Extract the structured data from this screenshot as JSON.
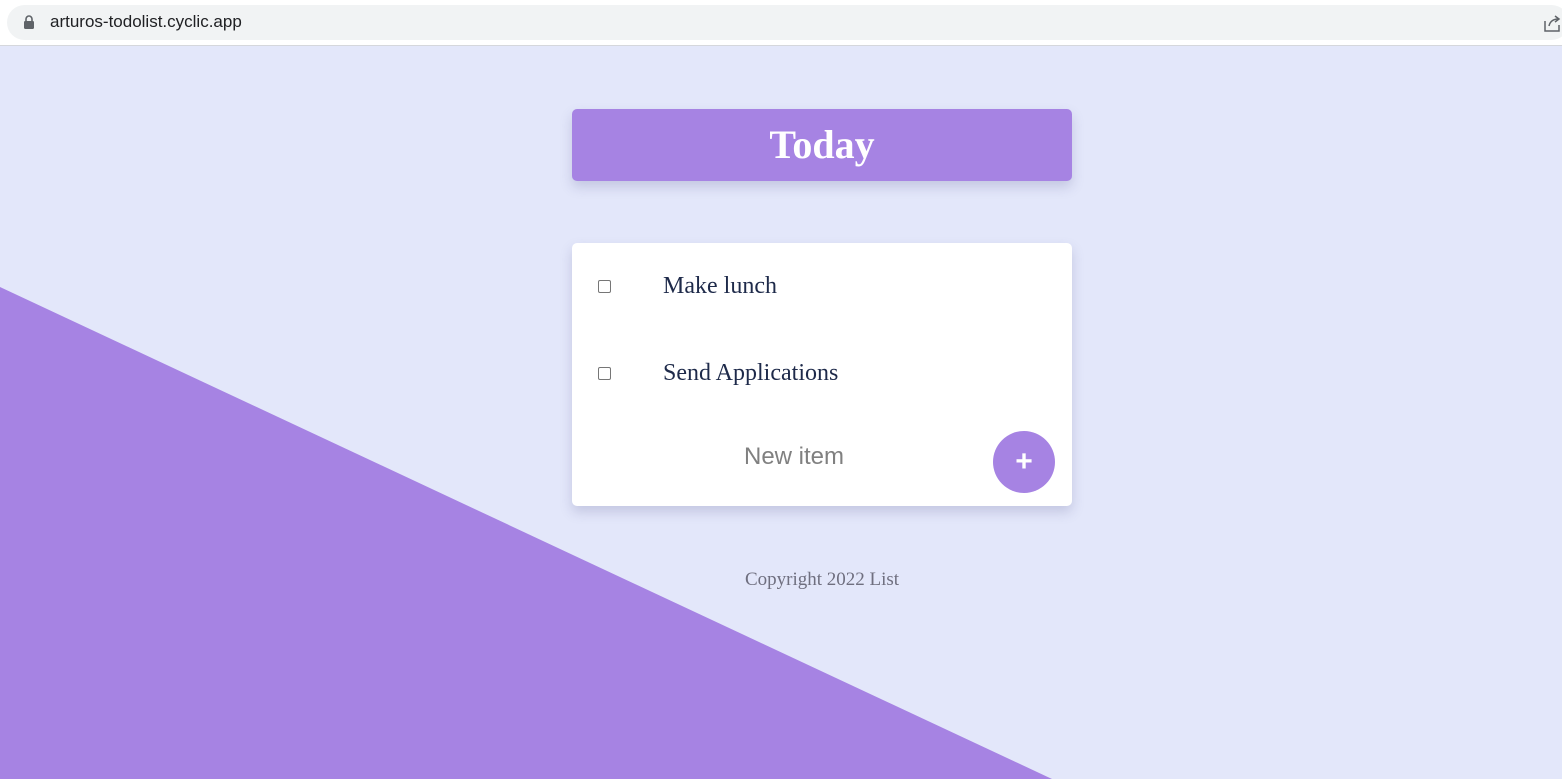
{
  "browser": {
    "url": "arturos-todolist.cyclic.app",
    "lock_icon": "lock-icon",
    "share_icon": "share-icon"
  },
  "colors": {
    "page_background": "#e3e7fa",
    "accent": "#a683e3",
    "item_text": "#1e2a4a"
  },
  "list": {
    "title": "Today",
    "items": [
      {
        "label": "Make lunch",
        "checked": false
      },
      {
        "label": "Send Applications",
        "checked": false
      }
    ],
    "new_item": {
      "value": "",
      "placeholder": "New item"
    },
    "add_button_label": "+"
  },
  "footer": {
    "text": "Copyright 2022 List"
  }
}
